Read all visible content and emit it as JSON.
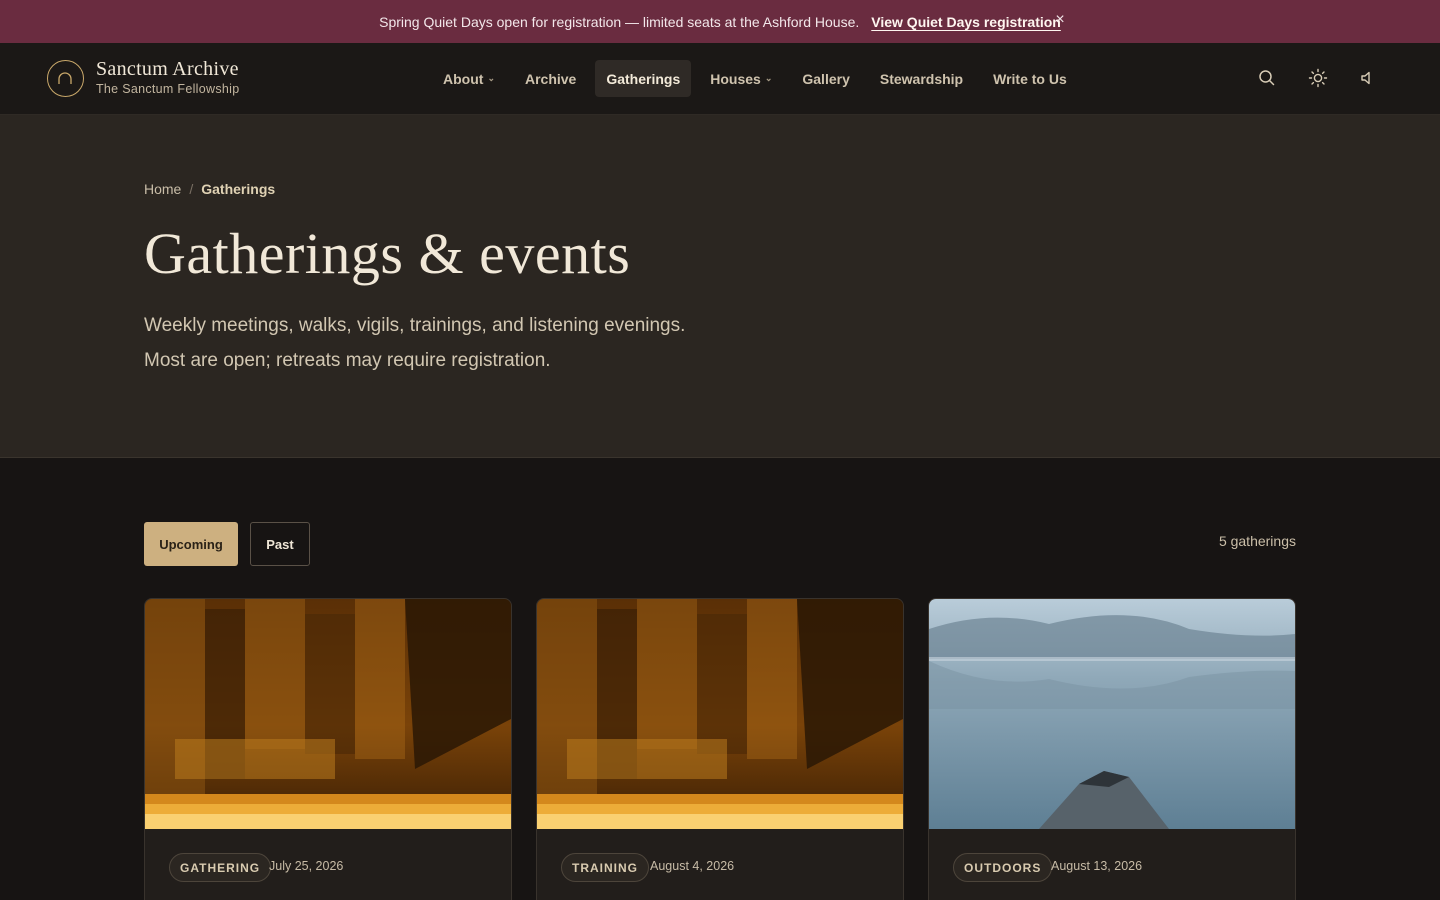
{
  "banner": {
    "message": "Spring Quiet Days open for registration — limited seats at the Ashford House.",
    "link_label": "View Quiet Days registration",
    "close_label": "×"
  },
  "brand": {
    "title": "Sanctum Archive",
    "subtitle": "The Sanctum Fellowship"
  },
  "nav": {
    "about": "About",
    "archive": "Archive",
    "gatherings": "Gatherings",
    "houses": "Houses",
    "gallery": "Gallery",
    "stewardship": "Stewardship",
    "write": "Write to Us"
  },
  "header_icons": [
    "search-icon",
    "sun-icon",
    "speaker-icon"
  ],
  "breadcrumb": {
    "home": "Home",
    "separator": "/",
    "current": "Gatherings"
  },
  "hero": {
    "title": "Gatherings & events",
    "lead_line1": "Weekly meetings, walks, vigils, trainings, and listening evenings.",
    "lead_line2": "Most are open; retreats may require registration."
  },
  "filters": {
    "upcoming": "Upcoming",
    "past": "Past",
    "selected": "Upcoming"
  },
  "count_label": "5 gatherings",
  "cards": [
    {
      "tag": "GATHERING",
      "date": "July 25, 2026",
      "image": "candlelit-chapel"
    },
    {
      "tag": "TRAINING",
      "date": "August 4, 2026",
      "image": "candlelit-chapel"
    },
    {
      "tag": "OUTDOORS",
      "date": "August 13, 2026",
      "image": "misty-lake"
    }
  ],
  "colors": {
    "banner": "#6a2c40",
    "accent": "#cdb080",
    "page_bg": "#171413",
    "hero_bg": "#2b2621"
  }
}
